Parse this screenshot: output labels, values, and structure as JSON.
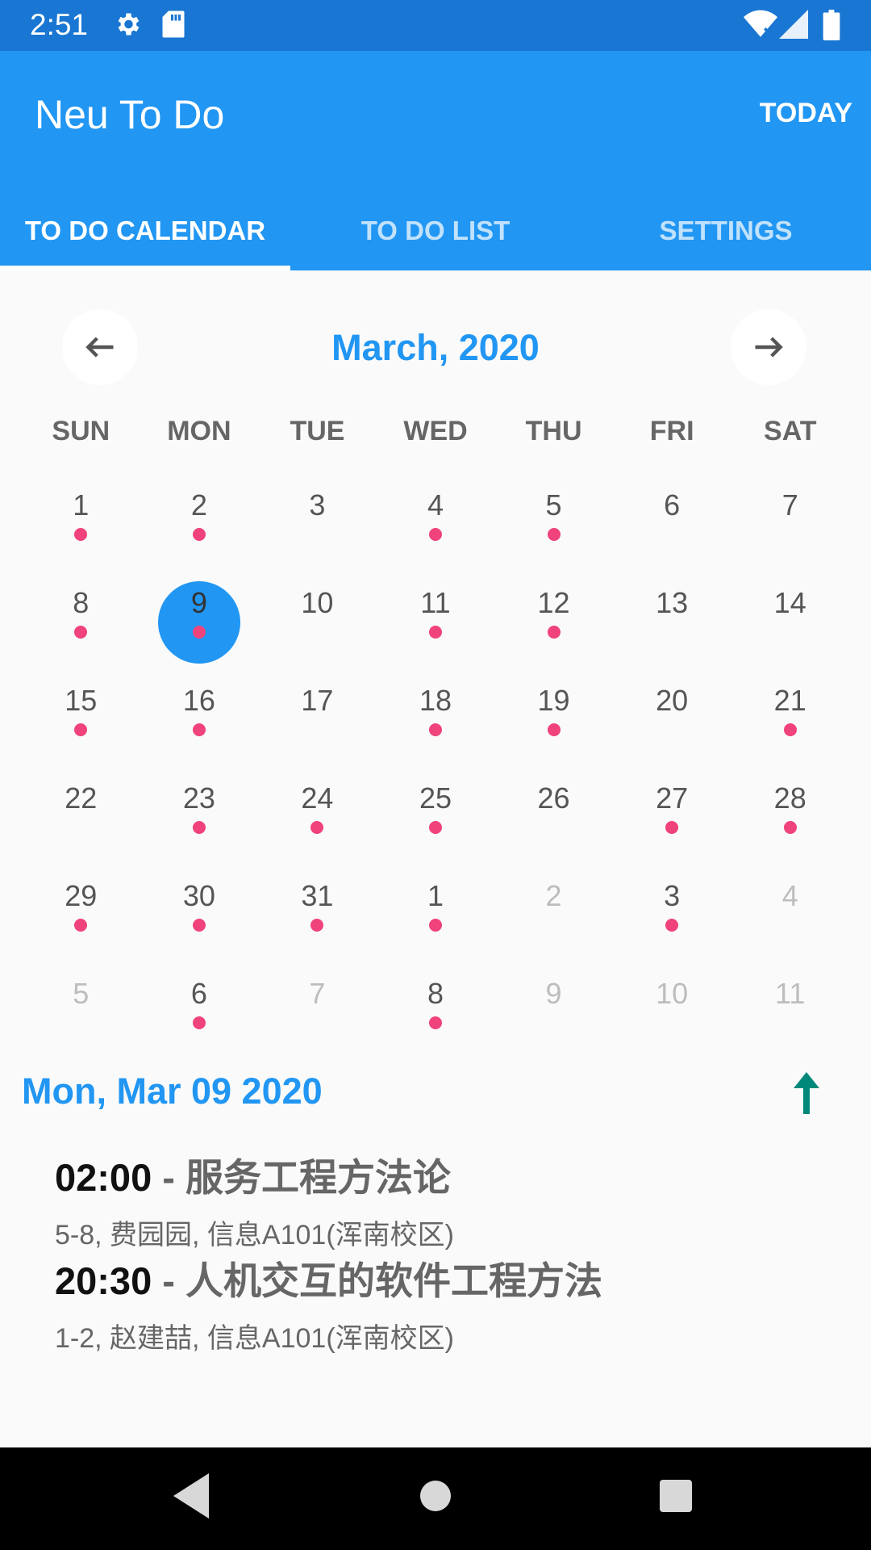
{
  "status_bar": {
    "time": "2:51",
    "icons": [
      "gear-icon",
      "sd-card-icon",
      "wifi-icon",
      "cell-signal-icon",
      "battery-icon"
    ]
  },
  "app_bar": {
    "title": "Neu To Do",
    "today_label": "TODAY",
    "tabs": [
      {
        "label": "TO DO CALENDAR",
        "active": true
      },
      {
        "label": "TO DO LIST",
        "active": false
      },
      {
        "label": "SETTINGS",
        "active": false
      }
    ]
  },
  "calendar": {
    "month_title": "March, 2020",
    "prev_icon": "arrow-left-icon",
    "next_icon": "arrow-right-icon",
    "weekdays": [
      "SUN",
      "MON",
      "TUE",
      "WED",
      "THU",
      "FRI",
      "SAT"
    ],
    "days": [
      {
        "day": "1",
        "muted": false,
        "event": true
      },
      {
        "day": "2",
        "muted": false,
        "event": true
      },
      {
        "day": "3",
        "muted": false,
        "event": false
      },
      {
        "day": "4",
        "muted": false,
        "event": true
      },
      {
        "day": "5",
        "muted": false,
        "event": true
      },
      {
        "day": "6",
        "muted": false,
        "event": false
      },
      {
        "day": "7",
        "muted": false,
        "event": false
      },
      {
        "day": "8",
        "muted": false,
        "event": true
      },
      {
        "day": "9",
        "muted": false,
        "event": true,
        "selected": true
      },
      {
        "day": "10",
        "muted": false,
        "event": false
      },
      {
        "day": "11",
        "muted": false,
        "event": true
      },
      {
        "day": "12",
        "muted": false,
        "event": true
      },
      {
        "day": "13",
        "muted": false,
        "event": false
      },
      {
        "day": "14",
        "muted": false,
        "event": false
      },
      {
        "day": "15",
        "muted": false,
        "event": true
      },
      {
        "day": "16",
        "muted": false,
        "event": true
      },
      {
        "day": "17",
        "muted": false,
        "event": false
      },
      {
        "day": "18",
        "muted": false,
        "event": true
      },
      {
        "day": "19",
        "muted": false,
        "event": true
      },
      {
        "day": "20",
        "muted": false,
        "event": false
      },
      {
        "day": "21",
        "muted": false,
        "event": true
      },
      {
        "day": "22",
        "muted": false,
        "event": false
      },
      {
        "day": "23",
        "muted": false,
        "event": true
      },
      {
        "day": "24",
        "muted": false,
        "event": true
      },
      {
        "day": "25",
        "muted": false,
        "event": true
      },
      {
        "day": "26",
        "muted": false,
        "event": false
      },
      {
        "day": "27",
        "muted": false,
        "event": true
      },
      {
        "day": "28",
        "muted": false,
        "event": true
      },
      {
        "day": "29",
        "muted": false,
        "event": true
      },
      {
        "day": "30",
        "muted": false,
        "event": true
      },
      {
        "day": "31",
        "muted": false,
        "event": true
      },
      {
        "day": "1",
        "muted": false,
        "event": true
      },
      {
        "day": "2",
        "muted": true,
        "event": false
      },
      {
        "day": "3",
        "muted": false,
        "event": true
      },
      {
        "day": "4",
        "muted": true,
        "event": false
      },
      {
        "day": "5",
        "muted": true,
        "event": false
      },
      {
        "day": "6",
        "muted": false,
        "event": true
      },
      {
        "day": "7",
        "muted": true,
        "event": false
      },
      {
        "day": "8",
        "muted": false,
        "event": true
      },
      {
        "day": "9",
        "muted": true,
        "event": false
      },
      {
        "day": "10",
        "muted": true,
        "event": false
      },
      {
        "day": "11",
        "muted": true,
        "event": false
      }
    ]
  },
  "detail": {
    "date": "Mon, Mar 09 2020",
    "collapse_icon": "arrow-up-icon",
    "events": [
      {
        "time": "02:00",
        "separator": " - ",
        "title": "服务工程方法论",
        "sub": "5-8, 费园园, 信息A101(浑南校区)"
      },
      {
        "time": "20:30",
        "separator": " - ",
        "title": "人机交互的软件工程方法",
        "sub": "1-2, 赵建喆, 信息A101(浑南校区)"
      }
    ]
  },
  "nav_bar": {
    "icons": [
      "back-icon",
      "home-icon",
      "recents-icon"
    ]
  },
  "colors": {
    "primary": "#2196f3",
    "status_bar": "#1976d2",
    "event_dot": "#f0427b",
    "collapse_arrow": "#00897b"
  }
}
